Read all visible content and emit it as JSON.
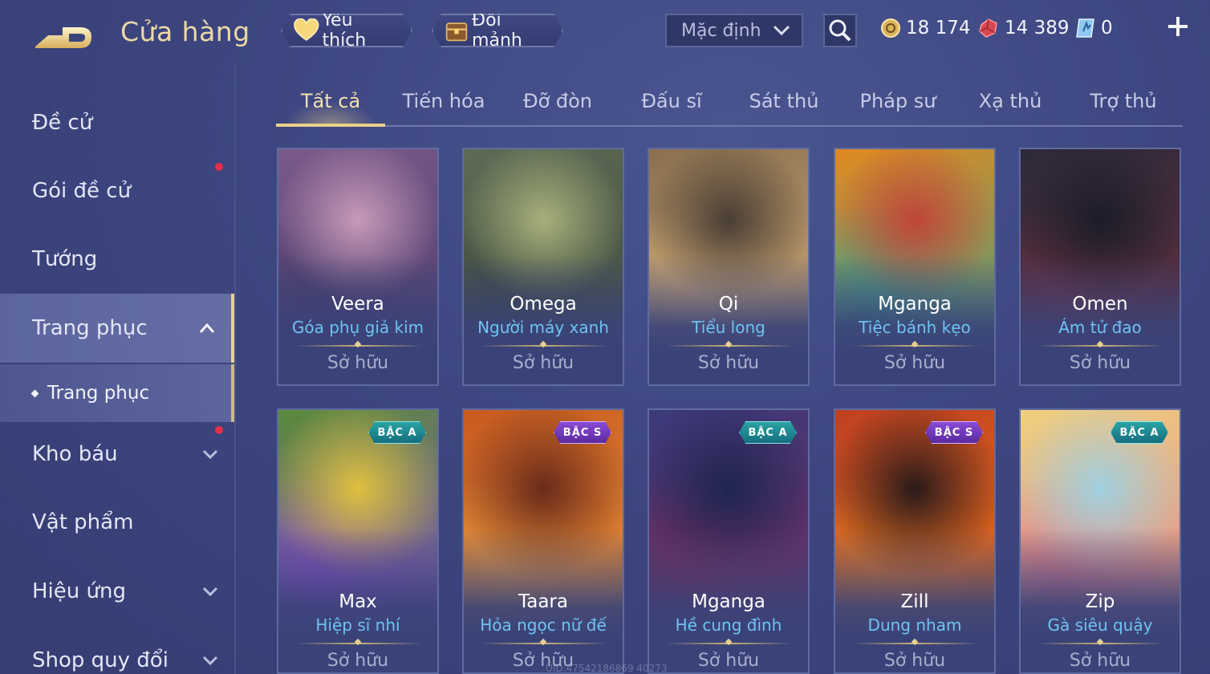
{
  "header": {
    "title": "Cửa hàng",
    "favorites_label": "Yêu thích",
    "exchange_label": "Đổi mảnh",
    "sort_value": "Mặc định",
    "currency": {
      "gold": "18 174",
      "ruby": "14 389",
      "voucher": "0"
    }
  },
  "sidebar": {
    "items": [
      {
        "label": "Đề cử"
      },
      {
        "label": "Gói đề cử"
      },
      {
        "label": "Tướng"
      },
      {
        "label": "Trang phục"
      },
      {
        "label": "Kho báu"
      },
      {
        "label": "Vật phẩm"
      },
      {
        "label": "Hiệu ứng"
      },
      {
        "label": "Shop quy đổi"
      }
    ],
    "sub_item": "Trang phục"
  },
  "tabs": [
    "Tất cả",
    "Tiến hóa",
    "Đỡ đòn",
    "Đấu sĩ",
    "Sát thủ",
    "Pháp sư",
    "Xạ thủ",
    "Trợ thủ"
  ],
  "cards": [
    {
      "hero": "Veera",
      "skin": "Góa phụ giả kim",
      "status": "Sở hữu",
      "badge": "",
      "colors": [
        "#7a5a8a",
        "#4a3a6a",
        "#c79ab8"
      ]
    },
    {
      "hero": "Omega",
      "skin": "Người máy xanh",
      "status": "Sở hữu",
      "badge": "",
      "colors": [
        "#5e6a55",
        "#3d4a3e",
        "#a7b07a"
      ]
    },
    {
      "hero": "Qi",
      "skin": "Tiểu long",
      "status": "Sở hữu",
      "badge": "",
      "colors": [
        "#8a7050",
        "#d6b07a",
        "#4a3e35"
      ]
    },
    {
      "hero": "Mganga",
      "skin": "Tiệc bánh kẹo",
      "status": "Sở hữu",
      "badge": "",
      "colors": [
        "#e08a20",
        "#3fa08a",
        "#c0453a"
      ]
    },
    {
      "hero": "Omen",
      "skin": "Ám tử đao",
      "status": "Sở hữu",
      "badge": "",
      "colors": [
        "#2c2a3a",
        "#6a3040",
        "#1c1c28"
      ]
    },
    {
      "hero": "Max",
      "skin": "Hiệp sĩ nhí",
      "status": "Sở hữu",
      "badge": "BẬC A",
      "colors": [
        "#5a8a3a",
        "#8a4ad0",
        "#e0c040"
      ]
    },
    {
      "hero": "Taara",
      "skin": "Hỏa ngọc nữ đế",
      "status": "Sở hữu",
      "badge": "BẬC S",
      "colors": [
        "#c85a20",
        "#f0a040",
        "#6a2a1a"
      ]
    },
    {
      "hero": "Mganga",
      "skin": "Hề cung đình",
      "status": "Sở hữu",
      "badge": "BẬC A",
      "colors": [
        "#3a3a7a",
        "#7a2a5a",
        "#1e2450"
      ]
    },
    {
      "hero": "Zill",
      "skin": "Dung nham",
      "status": "Sở hữu",
      "badge": "BẬC S",
      "colors": [
        "#c04020",
        "#f08020",
        "#2a1a1a"
      ]
    },
    {
      "hero": "Zip",
      "skin": "Gà siêu quậy",
      "status": "Sở hữu",
      "badge": "BẬC A",
      "colors": [
        "#f0d080",
        "#e07a8a",
        "#a0d0e0"
      ]
    }
  ],
  "footer_uid": "UID:47542186869 40273"
}
